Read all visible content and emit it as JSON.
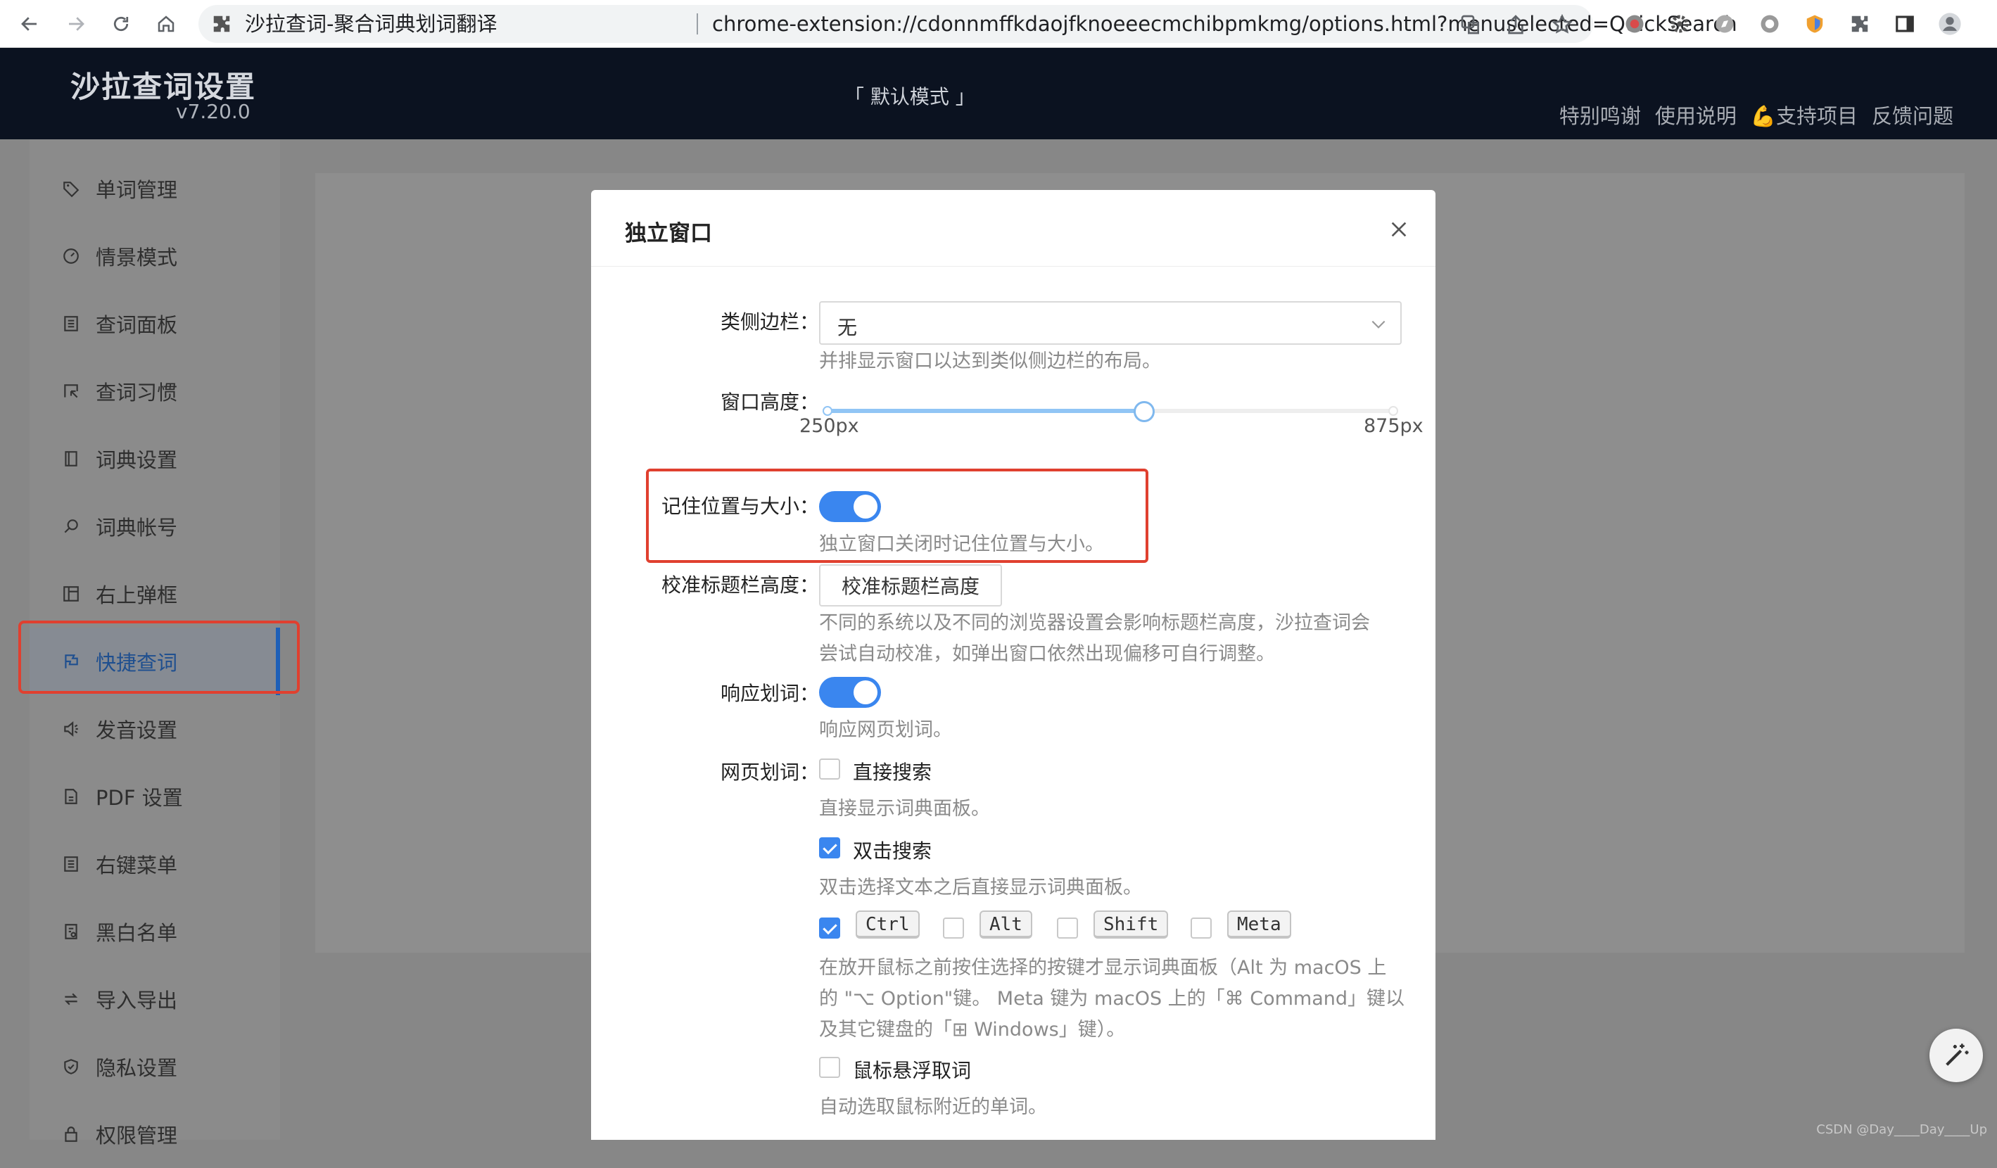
{
  "browser": {
    "tab_title": "沙拉查词-聚合词典划词翻译",
    "url": "chrome-extension://cdonnmffkdaojfknoeeecmchibpmkmg/options.html?menuselected=QuickSearch"
  },
  "app": {
    "title": "沙拉查词设置",
    "version": "v7.20.0",
    "mode": "「 默认模式 」",
    "links": [
      "特别鸣谢",
      "使用说明",
      "💪支持项目",
      "反馈问题"
    ]
  },
  "sidebar": {
    "items": [
      {
        "label": "单词管理",
        "icon": "tag-icon"
      },
      {
        "label": "情景模式",
        "icon": "dashboard-icon"
      },
      {
        "label": "查词面板",
        "icon": "panel-icon"
      },
      {
        "label": "查词习惯",
        "icon": "cursor-select-icon"
      },
      {
        "label": "词典设置",
        "icon": "book-icon"
      },
      {
        "label": "词典帐号",
        "icon": "search-icon"
      },
      {
        "label": "右上弹框",
        "icon": "layout-icon"
      },
      {
        "label": "快捷查词",
        "icon": "flag-icon",
        "active": true
      },
      {
        "label": "发音设置",
        "icon": "sound-icon"
      },
      {
        "label": "PDF 设置",
        "icon": "file-icon"
      },
      {
        "label": "右键菜单",
        "icon": "menu-list-icon"
      },
      {
        "label": "黑白名单",
        "icon": "file-check-icon"
      },
      {
        "label": "导入导出",
        "icon": "swap-icon"
      },
      {
        "label": "隐私设置",
        "icon": "shield-icon"
      },
      {
        "label": "权限管理",
        "icon": "lock-icon"
      }
    ]
  },
  "modal": {
    "title": "独立窗口",
    "fields": {
      "sidebar_like": {
        "label": "类侧边栏：",
        "value": "无",
        "help": "并排显示窗口以达到类似侧边栏的布局。"
      },
      "window_height": {
        "label": "窗口高度：",
        "min_label": "250px",
        "max_label": "875px",
        "value_fraction": 0.56
      },
      "remember": {
        "label": "记住位置与大小：",
        "enabled": true,
        "help": "独立窗口关闭时记住位置与大小。"
      },
      "calibrate": {
        "label": "校准标题栏高度：",
        "button": "校准标题栏高度",
        "help_line1": "不同的系统以及不同的浏览器设置会影响标题栏高度，沙拉查词会",
        "help_line2": "尝试自动校准，如弹出窗口依然出现偏移可自行调整。"
      },
      "respond_selection": {
        "label": "响应划词：",
        "enabled": true,
        "help": "响应网页划词。"
      },
      "page_selection": {
        "label": "网页划词：",
        "direct": {
          "label": "直接搜索",
          "checked": false,
          "help": "直接显示词典面板。"
        },
        "double_click": {
          "label": "双击搜索",
          "checked": true,
          "help": "双击选择文本之后直接显示词典面板。"
        },
        "keys": [
          {
            "label": "Ctrl",
            "checked": true
          },
          {
            "label": "Alt",
            "checked": false
          },
          {
            "label": "Shift",
            "checked": false
          },
          {
            "label": "Meta",
            "checked": false
          }
        ],
        "keys_help_line1": "在放开鼠标之前按住选择的按键才显示词典面板（Alt 为 macOS 上",
        "keys_help_line2": "的 \"⌥ Option\"键。 Meta 键为 macOS 上的「⌘ Command」键以",
        "keys_help_line3": "及其它键盘的「⊞ Windows」键）。",
        "hover": {
          "label": "鼠标悬浮取词",
          "checked": false,
          "help": "自动选取鼠标附近的单词。"
        }
      }
    }
  },
  "watermark": "CSDN @Day____Day____Up",
  "colors": {
    "accent": "#3a86ef",
    "highlight_box": "#e0402f",
    "header_bg": "#0b1220"
  }
}
